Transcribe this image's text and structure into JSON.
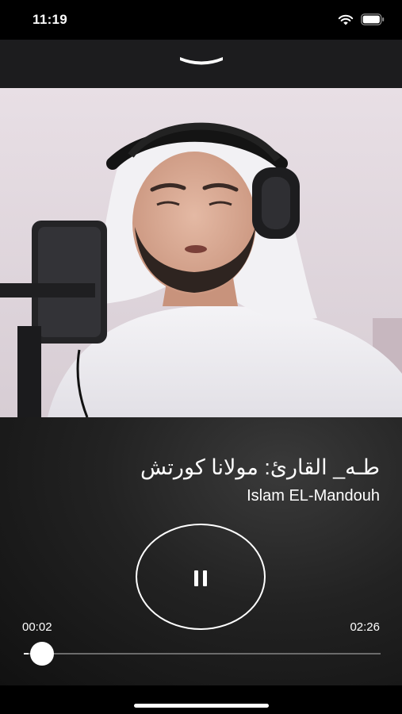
{
  "status_bar": {
    "time": "11:19",
    "wifi_icon": "wifi-icon",
    "battery_icon": "battery-icon"
  },
  "header": {
    "collapse_icon": "chevron-down-icon"
  },
  "track": {
    "title": "طـه_ القارئ: مولانا كورتش",
    "artist": "Islam EL-Mandouh"
  },
  "controls": {
    "play_state_icon": "pause-icon"
  },
  "progress": {
    "elapsed": "00:02",
    "total": "02:26",
    "fraction": 0.0137
  },
  "colors": {
    "background": "#000000",
    "header": "#1c1c1e",
    "accent": "#ffffff",
    "track": "#6b6b6b"
  }
}
